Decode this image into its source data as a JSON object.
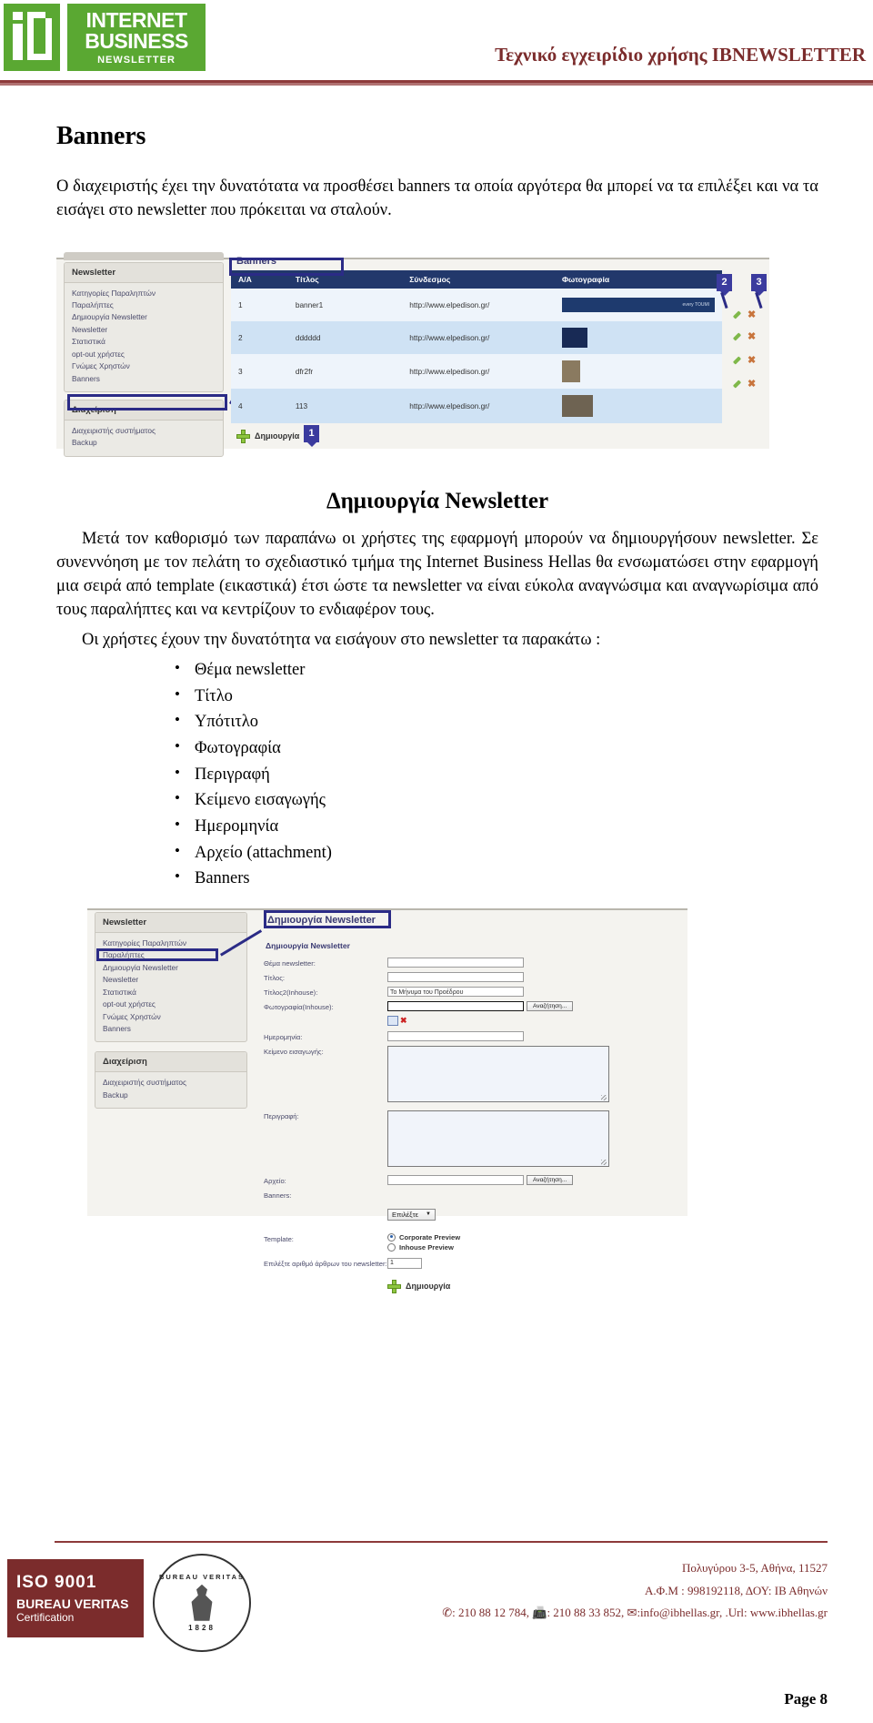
{
  "header": {
    "logo": {
      "monogram": "ib",
      "line1": "INTERNET",
      "line2": "BUSINESS",
      "line3": "NEWSLETTER"
    },
    "doc_title": "Τεχνικό εγχειρίδιο χρήσης IBNEWSLETTER"
  },
  "sections": {
    "banners": {
      "heading": "Banners",
      "paragraph": "Ο διαχειριστής έχει την δυνατότατα να προσθέσει banners τα οποία αργότερα θα μπορεί να τα επιλέξει και να τα εισάγει στο newsletter που πρόκειται να σταλούν."
    },
    "create_newsletter": {
      "heading": "Δημιουργία Newsletter",
      "paragraph1": "Μετά τον καθορισμό των παραπάνω οι χρήστες της εφαρμογή μπορούν να δημιουργήσουν newsletter. Σε συνεννόηση με τον πελάτη το σχεδιαστικό τμήμα της Internet Business Hellas θα ενσωματώσει στην εφαρμογή μια σειρά από template (εικαστικά) έτσι ώστε τα newsletter να είναι εύκολα αναγνώσιμα και αναγνωρίσιμα από τους παραλήπτες και να κεντρίζουν το ενδιαφέρον τους.",
      "paragraph2": "Οι χρήστες έχουν την δυνατότητα να εισάγουν στο newsletter τα παρακάτω :",
      "list": [
        "Θέμα newsletter",
        "Τίτλο",
        "Υπότιτλο",
        "Φωτογραφία",
        "Περιγραφή",
        "Κείμενο εισαγωγής",
        "Ημερομηνία",
        "Αρχείο (attachment)",
        "Banners"
      ]
    }
  },
  "screenshot_banners": {
    "sidebar": {
      "section1_title": "Newsletter",
      "section1_items": [
        "Κατηγορίες Παραληπτών",
        "Παραλήπτες",
        "Δημιουργία Newsletter",
        "Newsletter",
        "Στατιστικά",
        "opt-out χρήστες",
        "Γνώμες Χρηστών",
        "Banners"
      ],
      "highlighted_item": "Banners",
      "section2_title": "Διαχείριση",
      "section2_items": [
        "Διαχειριστής συστήματος",
        "Backup"
      ]
    },
    "pane_title": "Banners",
    "table": {
      "columns": [
        "A/A",
        "Τίτλος",
        "Σύνδεσμος",
        "Φωτογραφία"
      ],
      "rows": [
        {
          "aa": "1",
          "title": "banner1",
          "link": "http://www.elpedison.gr/",
          "photo": "banner-strip"
        },
        {
          "aa": "2",
          "title": "dddddd",
          "link": "http://www.elpedison.gr/",
          "photo": "space-thumb"
        },
        {
          "aa": "3",
          "title": "dfr2fr",
          "link": "http://www.elpedison.gr/",
          "photo": "person-thumb"
        },
        {
          "aa": "4",
          "title": "113",
          "link": "http://www.elpedison.gr/",
          "photo": "photo-thumb"
        }
      ],
      "banner_thumb_text": "every TOUMI"
    },
    "create_button": "Δημιουργία",
    "callouts": [
      "1",
      "2",
      "3"
    ],
    "row_action_icons": [
      "edit-pencil-icon",
      "delete-icon"
    ]
  },
  "screenshot_create_newsletter": {
    "sidebar": {
      "section1_title": "Newsletter",
      "section1_items": [
        "Κατηγορίες Παραληπτών",
        "Παραλήπτες",
        "Δημιουργία Newsletter",
        "Newsletter",
        "Στατιστικά",
        "opt-out χρήστες",
        "Γνώμες Χρηστών",
        "Banners"
      ],
      "highlighted_item": "Δημιουργία Newsletter",
      "section2_title": "Διαχείριση",
      "section2_items": [
        "Διαχειριστής συστήματος",
        "Backup"
      ]
    },
    "pane_title": "Δημιουργία Newsletter",
    "form_subtitle": "Δημιουργία Newsletter",
    "fields": [
      {
        "label": "Θέμα newsletter:",
        "value": ""
      },
      {
        "label": "Τίτλος:",
        "value": ""
      },
      {
        "label": "Τίτλος2(Inhouse):",
        "value": "Το Μήνυμα του Προέδρου"
      },
      {
        "label": "Φωτογραφία(Inhouse):",
        "value": ""
      },
      {
        "label": "Ημερομηνία:",
        "value": ""
      },
      {
        "label": "Κείμενο εισαγωγής:",
        "value": ""
      },
      {
        "label": "Περιγραφή:",
        "value": ""
      },
      {
        "label": "Αρχείο:",
        "value": ""
      },
      {
        "label": "Banners:",
        "value": ""
      },
      {
        "label": "Template:",
        "value": ""
      }
    ],
    "browse_button": "Αναζήτηση...",
    "select_label": "Επιλέξτε",
    "radio_options": [
      "Corporate Preview",
      "Inhouse Preview"
    ],
    "selected_radio": "Corporate Preview",
    "articles_label": "Επιλέξτε αριθμό άρθρων του newsletter:",
    "articles_value": "1",
    "submit_button": "Δημιουργία"
  },
  "footer": {
    "iso": {
      "line1": "ISO 9001",
      "line2": "BUREAU VERITAS",
      "line3": "Certification"
    },
    "bv": {
      "ring_top": "BUREAU VERITAS",
      "ring_bottom": "1828"
    },
    "address": "Πολυγύρου 3-5, Αθήνα, 11527",
    "tax": "Α.Φ.Μ : 998192118, ΔΟΥ: ΙΒ Αθηνών",
    "contact": "✆: 210 88 12 784, 📠: 210 88 33 852, ✉:info@ibhellas.gr, .Url: www.ibhellas.gr",
    "page": "Page 8"
  }
}
